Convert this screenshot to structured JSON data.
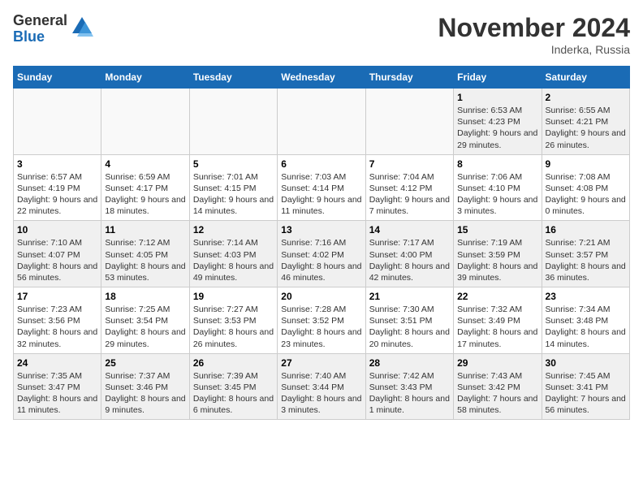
{
  "logo": {
    "general": "General",
    "blue": "Blue"
  },
  "title": "November 2024",
  "location": "Inderka, Russia",
  "days_header": [
    "Sunday",
    "Monday",
    "Tuesday",
    "Wednesday",
    "Thursday",
    "Friday",
    "Saturday"
  ],
  "weeks": [
    [
      {
        "day": "",
        "info": ""
      },
      {
        "day": "",
        "info": ""
      },
      {
        "day": "",
        "info": ""
      },
      {
        "day": "",
        "info": ""
      },
      {
        "day": "",
        "info": ""
      },
      {
        "day": "1",
        "info": "Sunrise: 6:53 AM\nSunset: 4:23 PM\nDaylight: 9 hours and 29 minutes."
      },
      {
        "day": "2",
        "info": "Sunrise: 6:55 AM\nSunset: 4:21 PM\nDaylight: 9 hours and 26 minutes."
      }
    ],
    [
      {
        "day": "3",
        "info": "Sunrise: 6:57 AM\nSunset: 4:19 PM\nDaylight: 9 hours and 22 minutes."
      },
      {
        "day": "4",
        "info": "Sunrise: 6:59 AM\nSunset: 4:17 PM\nDaylight: 9 hours and 18 minutes."
      },
      {
        "day": "5",
        "info": "Sunrise: 7:01 AM\nSunset: 4:15 PM\nDaylight: 9 hours and 14 minutes."
      },
      {
        "day": "6",
        "info": "Sunrise: 7:03 AM\nSunset: 4:14 PM\nDaylight: 9 hours and 11 minutes."
      },
      {
        "day": "7",
        "info": "Sunrise: 7:04 AM\nSunset: 4:12 PM\nDaylight: 9 hours and 7 minutes."
      },
      {
        "day": "8",
        "info": "Sunrise: 7:06 AM\nSunset: 4:10 PM\nDaylight: 9 hours and 3 minutes."
      },
      {
        "day": "9",
        "info": "Sunrise: 7:08 AM\nSunset: 4:08 PM\nDaylight: 9 hours and 0 minutes."
      }
    ],
    [
      {
        "day": "10",
        "info": "Sunrise: 7:10 AM\nSunset: 4:07 PM\nDaylight: 8 hours and 56 minutes."
      },
      {
        "day": "11",
        "info": "Sunrise: 7:12 AM\nSunset: 4:05 PM\nDaylight: 8 hours and 53 minutes."
      },
      {
        "day": "12",
        "info": "Sunrise: 7:14 AM\nSunset: 4:03 PM\nDaylight: 8 hours and 49 minutes."
      },
      {
        "day": "13",
        "info": "Sunrise: 7:16 AM\nSunset: 4:02 PM\nDaylight: 8 hours and 46 minutes."
      },
      {
        "day": "14",
        "info": "Sunrise: 7:17 AM\nSunset: 4:00 PM\nDaylight: 8 hours and 42 minutes."
      },
      {
        "day": "15",
        "info": "Sunrise: 7:19 AM\nSunset: 3:59 PM\nDaylight: 8 hours and 39 minutes."
      },
      {
        "day": "16",
        "info": "Sunrise: 7:21 AM\nSunset: 3:57 PM\nDaylight: 8 hours and 36 minutes."
      }
    ],
    [
      {
        "day": "17",
        "info": "Sunrise: 7:23 AM\nSunset: 3:56 PM\nDaylight: 8 hours and 32 minutes."
      },
      {
        "day": "18",
        "info": "Sunrise: 7:25 AM\nSunset: 3:54 PM\nDaylight: 8 hours and 29 minutes."
      },
      {
        "day": "19",
        "info": "Sunrise: 7:27 AM\nSunset: 3:53 PM\nDaylight: 8 hours and 26 minutes."
      },
      {
        "day": "20",
        "info": "Sunrise: 7:28 AM\nSunset: 3:52 PM\nDaylight: 8 hours and 23 minutes."
      },
      {
        "day": "21",
        "info": "Sunrise: 7:30 AM\nSunset: 3:51 PM\nDaylight: 8 hours and 20 minutes."
      },
      {
        "day": "22",
        "info": "Sunrise: 7:32 AM\nSunset: 3:49 PM\nDaylight: 8 hours and 17 minutes."
      },
      {
        "day": "23",
        "info": "Sunrise: 7:34 AM\nSunset: 3:48 PM\nDaylight: 8 hours and 14 minutes."
      }
    ],
    [
      {
        "day": "24",
        "info": "Sunrise: 7:35 AM\nSunset: 3:47 PM\nDaylight: 8 hours and 11 minutes."
      },
      {
        "day": "25",
        "info": "Sunrise: 7:37 AM\nSunset: 3:46 PM\nDaylight: 8 hours and 9 minutes."
      },
      {
        "day": "26",
        "info": "Sunrise: 7:39 AM\nSunset: 3:45 PM\nDaylight: 8 hours and 6 minutes."
      },
      {
        "day": "27",
        "info": "Sunrise: 7:40 AM\nSunset: 3:44 PM\nDaylight: 8 hours and 3 minutes."
      },
      {
        "day": "28",
        "info": "Sunrise: 7:42 AM\nSunset: 3:43 PM\nDaylight: 8 hours and 1 minute."
      },
      {
        "day": "29",
        "info": "Sunrise: 7:43 AM\nSunset: 3:42 PM\nDaylight: 7 hours and 58 minutes."
      },
      {
        "day": "30",
        "info": "Sunrise: 7:45 AM\nSunset: 3:41 PM\nDaylight: 7 hours and 56 minutes."
      }
    ]
  ]
}
